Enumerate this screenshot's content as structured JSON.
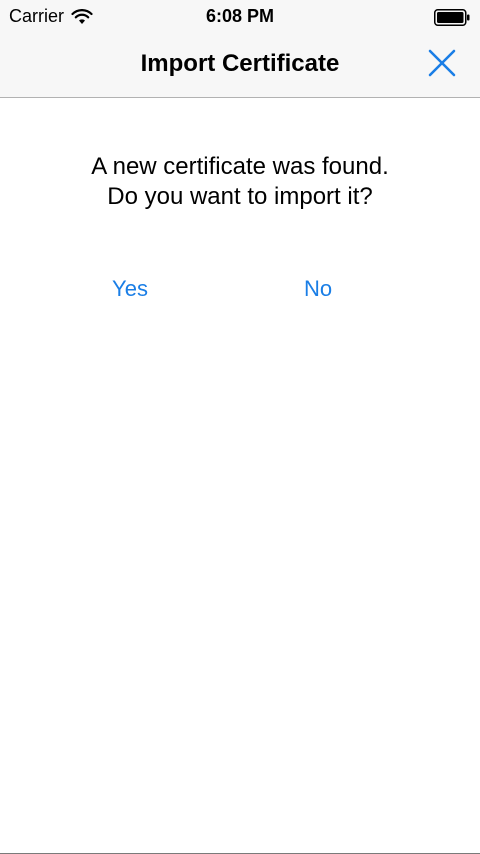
{
  "status_bar": {
    "carrier": "Carrier",
    "time": "6:08 PM",
    "wifi_icon": "wifi-icon",
    "battery_icon": "battery-icon"
  },
  "nav": {
    "title": "Import Certificate",
    "close_icon": "close-icon"
  },
  "dialog": {
    "message_line1": "A new certificate was found.",
    "message_line2": "Do you want to import it?",
    "yes_label": "Yes",
    "no_label": "No"
  },
  "colors": {
    "accent": "#1a7ee6",
    "bar_background": "#f7f7f7"
  }
}
